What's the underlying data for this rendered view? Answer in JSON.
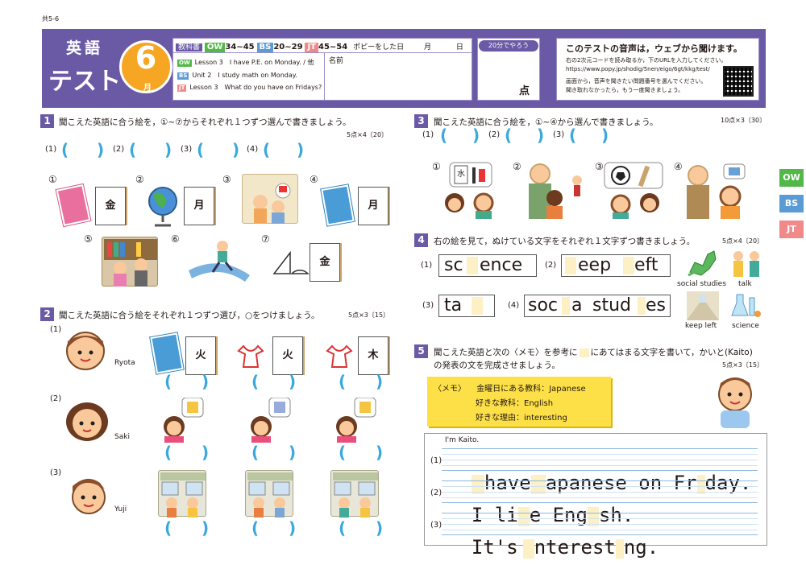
{
  "page_code": "共5-6",
  "header": {
    "title_line1": "英語",
    "title_line2": "テスト",
    "month": "6",
    "month_unit": "月",
    "textbook_label": "教科書",
    "ow_tag": "OW",
    "ow_pages": "34~45",
    "bs_tag": "BS",
    "bs_pages": "20~29",
    "jt_tag": "JT",
    "jt_pages": "45~54",
    "date_label": "ポピーをした日",
    "month_label": "月",
    "day_label": "日",
    "lessons": [
      {
        "tag": "OW",
        "text": "Lesson 3　I have P.E. on Monday. / 他"
      },
      {
        "tag": "BS",
        "text": "Unit 2　I study math on Monday."
      },
      {
        "tag": "JT",
        "text": "Lesson 3　What do you have on Fridays?"
      }
    ],
    "name_label": "名前",
    "time_badge": "20分でやろう",
    "score_unit": "点",
    "audio_title": "このテストの音声は，ウェブから聞けます。",
    "audio_lines": [
      "右の2次元コードを読み取るか，下のURLを入力してください。",
      "https://www.popy.jp/shodig/5nen/eigo/6gt/kkg/test/",
      "画面から，音声を聞きたい問題番号を選んでください。",
      "聞き取れなかったら，もう一度聞きましょう。"
    ]
  },
  "side_tabs": [
    {
      "label": "OW",
      "color": "#53b848"
    },
    {
      "label": "BS",
      "color": "#5b9bd5"
    },
    {
      "label": "JT",
      "color": "#f08a8a"
    }
  ],
  "q1": {
    "num": "1",
    "instruction": "聞こえた英語に合う絵を，①~⑦からそれぞれ１つずつ選んで書きましょう。",
    "points": "5点×4〔20〕",
    "labels": [
      "(1)",
      "(2)",
      "(3)",
      "(4)"
    ],
    "paren_open": "(",
    "paren_close": ")",
    "options": [
      "①",
      "②",
      "③",
      "④",
      "⑤",
      "⑥",
      "⑦"
    ],
    "card_chars": [
      "金",
      "月",
      "月",
      "金"
    ]
  },
  "q2": {
    "num": "2",
    "instruction": "聞こえた英語に合う絵をそれぞれ１つずつ選び，○をつけましょう。",
    "points": "5点×3〔15〕",
    "rows": [
      {
        "label": "(1)",
        "name": "Ryota",
        "cards": [
          "火",
          "火",
          "木"
        ]
      },
      {
        "label": "(2)",
        "name": "Saki"
      },
      {
        "label": "(3)",
        "name": "Yuji"
      }
    ]
  },
  "q3": {
    "num": "3",
    "instruction": "聞こえた英語に合う絵を，①~④から選んで書きましょう。",
    "points": "10点×3〔30〕",
    "labels": [
      "(1)",
      "(2)",
      "(3)"
    ],
    "options": [
      "①",
      "②",
      "③",
      "④"
    ],
    "board_char": "水"
  },
  "q4": {
    "num": "4",
    "instruction": "右の絵を見て，ぬけている文字をそれぞれ１文字ずつ書きましょう。",
    "points": "5点×4〔20〕",
    "items": [
      {
        "label": "(1)",
        "a": "sc",
        "b": "ence"
      },
      {
        "label": "(2)",
        "a": "",
        "b": "eep",
        "c": "eft"
      },
      {
        "label": "(3)",
        "a": "ta",
        "b": ""
      },
      {
        "label": "(4)",
        "a": "soc",
        "b": "a",
        "c": "stud",
        "d": "es"
      }
    ],
    "pic_labels": [
      "social studies",
      "talk",
      "keep left",
      "science"
    ]
  },
  "q5": {
    "num": "5",
    "instruction_line1": "聞こえた英語と次の〈メモ〉を参考に",
    "instruction_line1b": "にあてはまる文字を書いて，かいと(Kaito)",
    "instruction_line2": "の発表の文を完成させましょう。",
    "points": "5点×3〔15〕",
    "memo": [
      {
        "key": "〈メモ〉",
        "label": "金曜日にある教科：",
        "value": "Japanese"
      },
      {
        "key": "",
        "label": "好きな教科：",
        "value": "English"
      },
      {
        "key": "",
        "label": "好きな理由：",
        "value": "interesting"
      }
    ],
    "intro": "I'm Kaito.",
    "lines": [
      {
        "label": "(1)",
        "p1": "have",
        "p2": "apanese on Fr",
        "p3": "day."
      },
      {
        "label": "(2)",
        "p1": "I li",
        "p2": "e Eng",
        "p3": "sh."
      },
      {
        "label": "(3)",
        "p1": "It's",
        "p2": "nterest",
        "p3": "ng."
      }
    ]
  }
}
